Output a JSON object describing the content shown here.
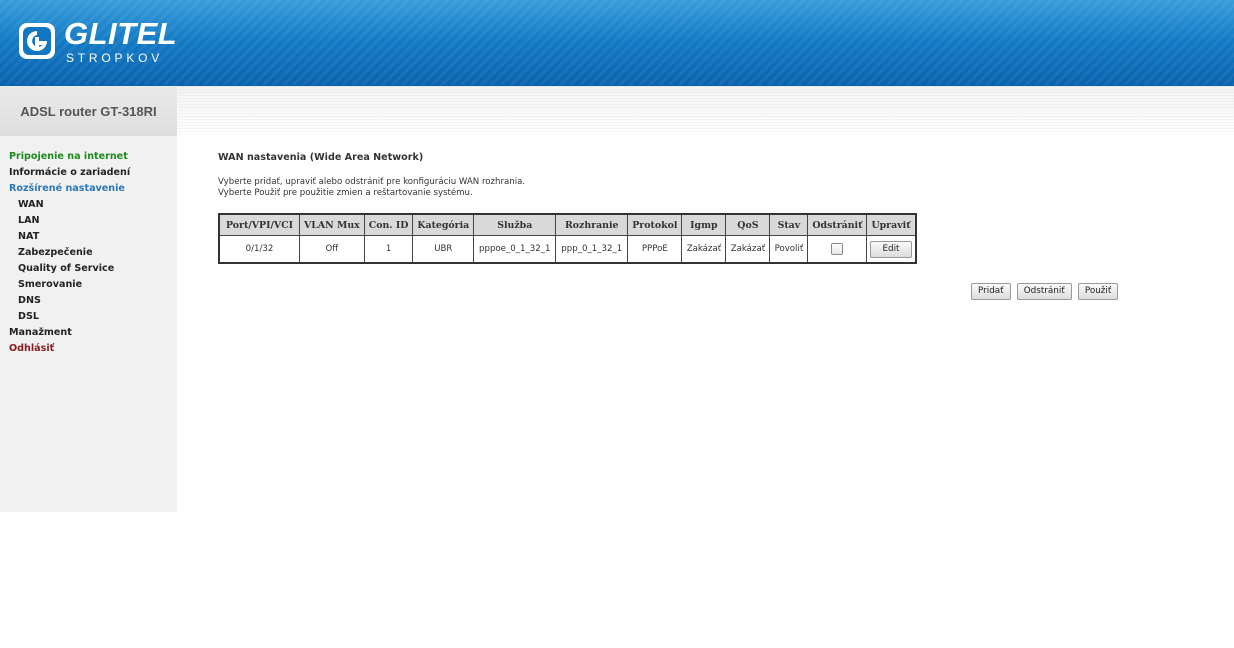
{
  "brand": {
    "name": "GLITEL",
    "subtitle": "STROPKOV",
    "model": "ADSL router GT-318RI"
  },
  "sidebar": {
    "items": [
      {
        "label": "Pripojenie na internet",
        "style": "green"
      },
      {
        "label": "Informácie o zariadení",
        "style": "dark"
      },
      {
        "label": "Rozšírené nastavenie",
        "style": "blue"
      },
      {
        "label": "WAN",
        "style": "sub"
      },
      {
        "label": "LAN",
        "style": "sub"
      },
      {
        "label": "NAT",
        "style": "sub"
      },
      {
        "label": "Zabezpečenie",
        "style": "sub"
      },
      {
        "label": "Quality of Service",
        "style": "sub"
      },
      {
        "label": "Smerovanie",
        "style": "sub"
      },
      {
        "label": "DNS",
        "style": "sub"
      },
      {
        "label": "DSL",
        "style": "sub"
      },
      {
        "label": "Manažment",
        "style": "dark"
      },
      {
        "label": "Odhlásiť",
        "style": "red"
      }
    ]
  },
  "main": {
    "title": "WAN nastavenia (Wide Area Network)",
    "desc_line1": "Vyberte pridať, upraviť alebo odstrániť pre konfiguráciu WAN rozhrania.",
    "desc_line2": "Vyberte Použiť pre použitie zmien a reštartovanie systému."
  },
  "table": {
    "headers": [
      "Port/VPI/VCI",
      "VLAN Mux",
      "Con. ID",
      "Kategória",
      "Služba",
      "Rozhranie",
      "Protokol",
      "Igmp",
      "QoS",
      "Stav",
      "Odstrániť",
      "Upraviť"
    ],
    "rows": [
      {
        "port": "0/1/32",
        "vlan_mux": "Off",
        "con_id": "1",
        "category": "UBR",
        "service": "pppoe_0_1_32_1",
        "interface": "ppp_0_1_32_1",
        "protocol": "PPPoE",
        "igmp": "Zakázať",
        "qos": "Zakázať",
        "state": "Povoliť",
        "remove_checked": false,
        "edit_label": "Edit"
      }
    ]
  },
  "actions": {
    "add": "Pridať",
    "remove": "Odstrániť",
    "apply": "Použiť"
  },
  "colors": {
    "header_blue": "#1277c2",
    "menu_green": "#1c8a1c",
    "menu_blue": "#2a78b8",
    "menu_red": "#8b1a1a"
  }
}
